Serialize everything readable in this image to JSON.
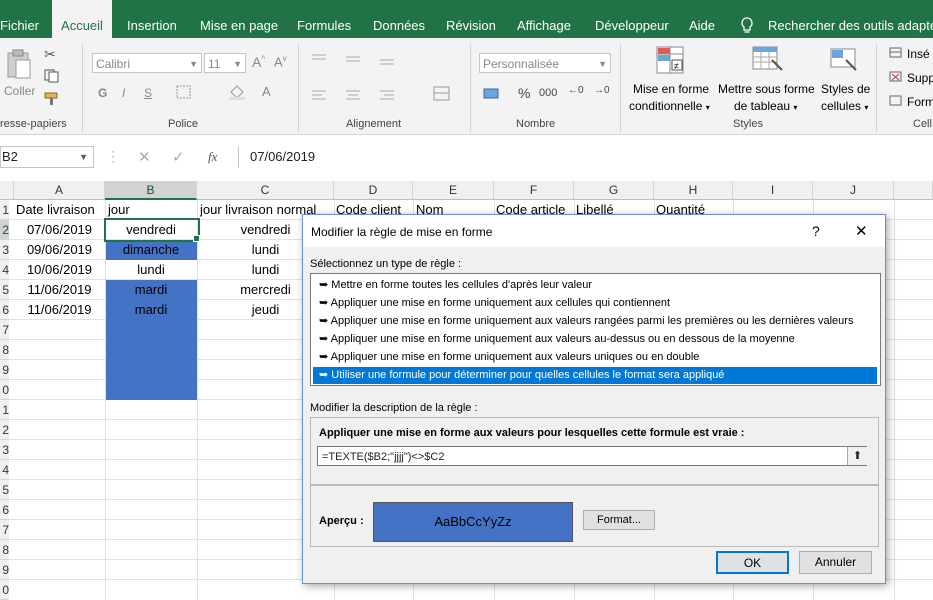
{
  "ribbon": {
    "tabs": [
      "Fichier",
      "Accueil",
      "Insertion",
      "Mise en page",
      "Formules",
      "Données",
      "Révision",
      "Affichage",
      "Développeur",
      "Aide",
      "Rechercher des outils adaptés"
    ],
    "active_tab": "Accueil",
    "clipboard": {
      "paste_label": "Coller",
      "group_label": "resse-papiers"
    },
    "font": {
      "name": "Calibri",
      "size": "11",
      "group_label": "Police",
      "bold": "G",
      "italic": "I",
      "underline": "S"
    },
    "alignment": {
      "group_label": "Alignement"
    },
    "number": {
      "format": "Personnalisée",
      "group_label": "Nombre",
      "percent": "%",
      "thousands": "000"
    },
    "styles": {
      "conditional": [
        "Mise en forme",
        "conditionnelle"
      ],
      "as_table": [
        "Mettre sous forme",
        "de tableau"
      ],
      "cell_styles": [
        "Styles de",
        "cellules"
      ],
      "group_label": "Styles"
    },
    "cells": {
      "insert": "Insé",
      "delete": "Supp",
      "format": "Form",
      "group_label": "Cell"
    }
  },
  "formula_bar": {
    "name_box": "B2",
    "fx": "fx",
    "value": "07/06/2019"
  },
  "columns": [
    "A",
    "B",
    "C",
    "D",
    "E",
    "F",
    "G",
    "H",
    "I",
    "J"
  ],
  "rows": [
    "1",
    "2",
    "3",
    "4",
    "5",
    "6",
    "7",
    "8",
    "9",
    "0",
    "1",
    "2",
    "3",
    "4",
    "5",
    "6",
    "7",
    "8",
    "9",
    "0"
  ],
  "headers": {
    "a": "Date livraison",
    "b": "jour",
    "c": "jour livraison normal",
    "d": "Code client",
    "e": "Nom",
    "f": "Code article",
    "g": "Libellé",
    "h": "Quantité"
  },
  "data_rows": [
    {
      "date": "07/06/2019",
      "jour": "vendredi",
      "normal": "vendredi"
    },
    {
      "date": "09/06/2019",
      "jour": "dimanche",
      "normal": "lundi"
    },
    {
      "date": "10/06/2019",
      "jour": "lundi",
      "normal": "lundi"
    },
    {
      "date": "11/06/2019",
      "jour": "mardi",
      "normal": "mercredi"
    },
    {
      "date": "11/06/2019",
      "jour": "mardi",
      "normal": "jeudi"
    }
  ],
  "colors": {
    "accent": "#217346",
    "highlight": "#4472c4",
    "selection": "#0078d7"
  },
  "dialog": {
    "title": "Modifier la règle de mise en forme",
    "help": "?",
    "close": "✕",
    "select_type_label": "Sélectionnez un type de règle :",
    "rule_types": [
      "Mettre en forme toutes les cellules d'après leur valeur",
      "Appliquer une mise en forme uniquement aux cellules qui contiennent",
      "Appliquer une mise en forme uniquement aux valeurs rangées parmi les premières ou les dernières valeurs",
      "Appliquer une mise en forme uniquement aux valeurs au-dessus ou en dessous de la moyenne",
      "Appliquer une mise en forme uniquement aux valeurs uniques ou en double",
      "Utiliser une formule pour déterminer pour quelles cellules le format sera appliqué"
    ],
    "selected_rule_index": 5,
    "edit_desc_label": "Modifier la description de la règle :",
    "formula_label": "Appliquer une mise en forme aux valeurs pour lesquelles cette formule est vraie :",
    "formula_value": "=TEXTE($B2;\"jjjj\")<>$C2",
    "preview_label": "Aperçu :",
    "preview_text": "AaBbCcYyZz",
    "format_button": "Format...",
    "ok_button": "OK",
    "cancel_button": "Annuler"
  }
}
